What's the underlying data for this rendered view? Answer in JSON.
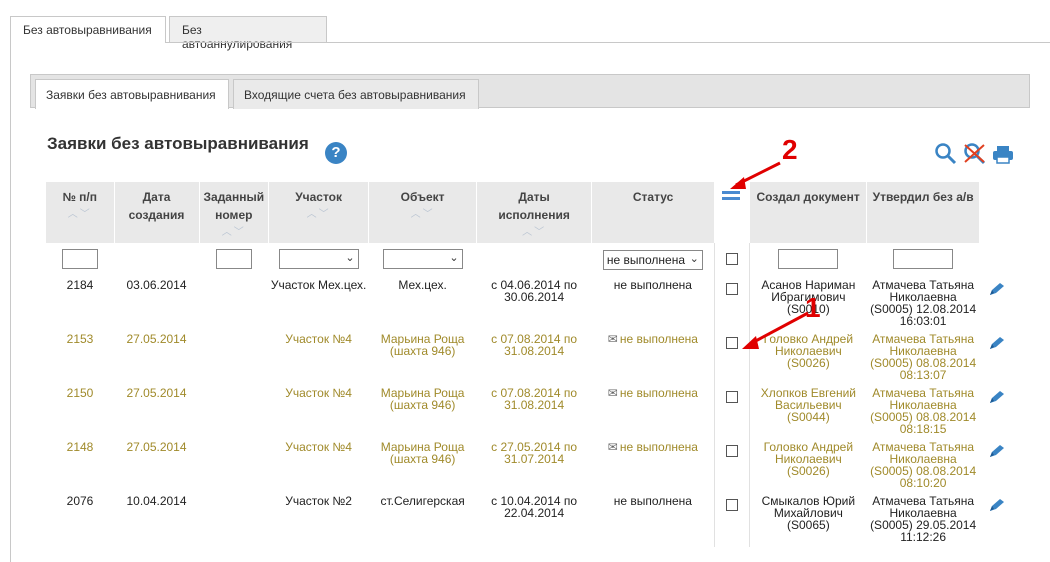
{
  "top_tabs": [
    {
      "label": "Без автовыравнивания",
      "active": true
    },
    {
      "label": "Без автоаннулирования",
      "active": false
    }
  ],
  "inner_tabs": [
    {
      "label": "Заявки без автовыравнивания",
      "active": true
    },
    {
      "label": "Входящие счета без автовыравнивания",
      "active": false
    }
  ],
  "page_title": "Заявки без автовыравнивания",
  "help_icon": "?",
  "columns": {
    "num": "№ п/п",
    "date": "Дата создания",
    "given_num": "Заданный номер",
    "section": "Участок",
    "object": "Объект",
    "dates": "Даты исполнения",
    "status": "Статус",
    "creator": "Создал документ",
    "approver": "Утвердил без а/в"
  },
  "filters": {
    "status_value": "не выполнена"
  },
  "rows": [
    {
      "num": "2184",
      "date": "03.06.2014",
      "given_num": "",
      "section": "Участок Мех.цех.",
      "object": "Мех.цех.",
      "dates": "с 04.06.2014 по 30.06.2014",
      "status": "не выполнена",
      "mail": false,
      "creator": "Асанов Нариман Ибрагимович (S0010)",
      "approver": "Атмачева Татьяна Николаевна (S0005) 12.08.2014 16:03:01",
      "style": "ok"
    },
    {
      "num": "2153",
      "date": "27.05.2014",
      "given_num": "",
      "section": "Участок №4",
      "object": "Марьина Роща (шахта 946)",
      "dates": "с 07.08.2014 по 31.08.2014",
      "status": "не выполнена",
      "mail": true,
      "creator": "Головко Андрей Николаевич (S0026)",
      "approver": "Атмачева Татьяна Николаевна (S0005) 08.08.2014 08:13:07",
      "style": "warn"
    },
    {
      "num": "2150",
      "date": "27.05.2014",
      "given_num": "",
      "section": "Участок №4",
      "object": "Марьина Роща (шахта 946)",
      "dates": "с 07.08.2014 по 31.08.2014",
      "status": "не выполнена",
      "mail": true,
      "creator": "Хлопков Евгений Васильевич (S0044)",
      "approver": "Атмачева Татьяна Николаевна (S0005) 08.08.2014 08:18:15",
      "style": "warn"
    },
    {
      "num": "2148",
      "date": "27.05.2014",
      "given_num": "",
      "section": "Участок №4",
      "object": "Марьина Роща (шахта 946)",
      "dates": "с 27.05.2014 по 31.07.2014",
      "status": "не выполнена",
      "mail": true,
      "creator": "Головко Андрей Николаевич (S0026)",
      "approver": "Атмачева Татьяна Николаевна (S0005) 08.08.2014 08:10:20",
      "style": "warn"
    },
    {
      "num": "2076",
      "date": "10.04.2014",
      "given_num": "",
      "section": "Участок №2",
      "object": "ст.Селигерская",
      "dates": "с 10.04.2014 по 22.04.2014",
      "status": "не выполнена",
      "mail": false,
      "creator": "Смыкалов Юрий Михайлович (S0065)",
      "approver": "Атмачева Татьяна Николаевна (S0005) 29.05.2014 11:12:26",
      "style": "ok"
    }
  ],
  "annotations": {
    "label1": "1",
    "label2": "2"
  },
  "icons": [
    "search-icon",
    "clear-filter-icon",
    "print-icon",
    "column-menu-icon",
    "edit-pencil-icon",
    "envelope-icon",
    "help-icon"
  ],
  "colors": {
    "link_olive": "#a08a2a",
    "accent_blue": "#3a84c4",
    "annotation_red": "#e00000"
  }
}
